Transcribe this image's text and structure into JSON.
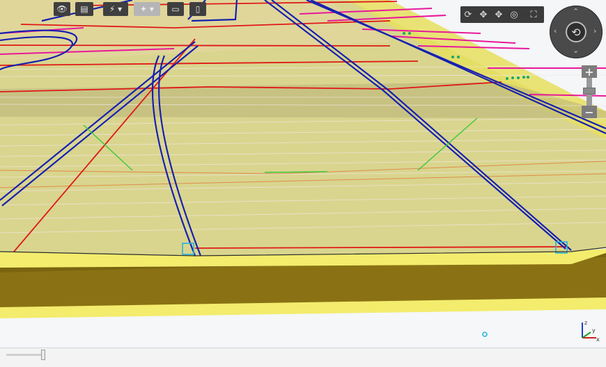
{
  "viewer": {
    "scene_colors": {
      "surface": "#d9d58e",
      "embankment": "#f2ea6a",
      "cut_face": "#8a7214",
      "curb_line": "#1620b0",
      "alignment": "#e01818",
      "offset": "#e8189a",
      "guide": "#3cc83c",
      "marker": "#26b4d8"
    }
  },
  "navigation": {
    "tools": [
      {
        "icon": "orbit-icon"
      },
      {
        "icon": "pan-icon"
      },
      {
        "icon": "move-icon"
      },
      {
        "icon": "look-around-icon"
      },
      {
        "icon": "fullscreen-icon"
      }
    ],
    "compass_icon": "orbit-center-icon",
    "zoom_in_label": "+",
    "zoom_out_label": "−"
  },
  "bottom_toolbar": {
    "slider_value": 0.95,
    "buttons": [
      {
        "icon": "eye-icon",
        "enabled": true
      },
      {
        "icon": "book-icon",
        "enabled": true
      },
      {
        "icon": "lightning-icon",
        "enabled": true
      },
      {
        "icon": "magic-wand-icon",
        "enabled": false
      },
      {
        "icon": "comment-icon",
        "enabled": true
      },
      {
        "icon": "document-icon",
        "enabled": true
      }
    ]
  },
  "axis_triad": {
    "x": "x",
    "y": "y",
    "z": "z"
  }
}
